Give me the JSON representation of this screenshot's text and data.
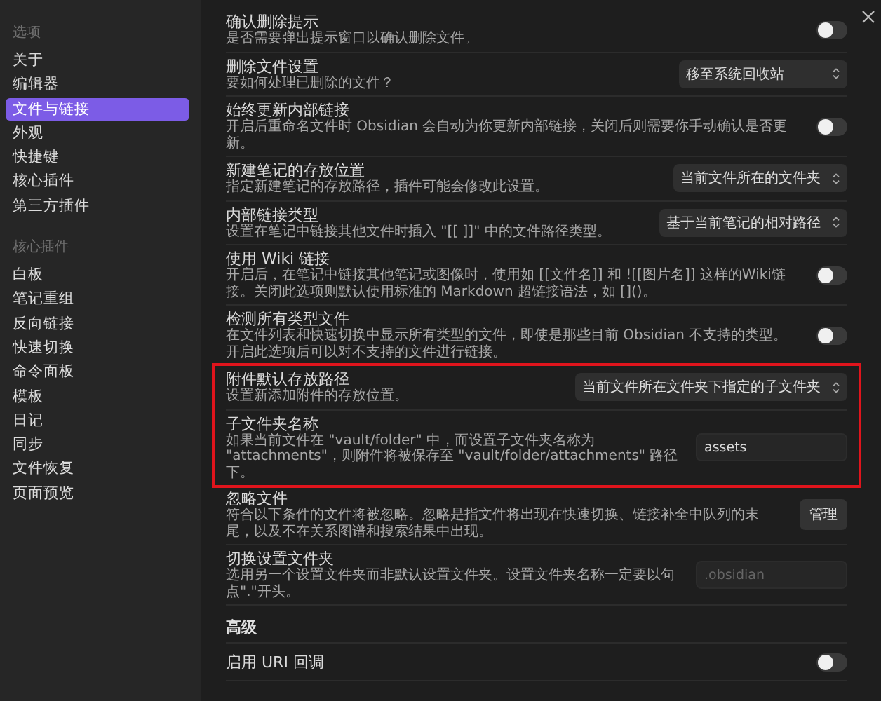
{
  "sidebar": {
    "sections": [
      {
        "heading": "选项",
        "items": [
          {
            "label": "关于",
            "selected": false
          },
          {
            "label": "编辑器",
            "selected": false
          },
          {
            "label": "文件与链接",
            "selected": true
          },
          {
            "label": "外观",
            "selected": false
          },
          {
            "label": "快捷键",
            "selected": false
          },
          {
            "label": "核心插件",
            "selected": false
          },
          {
            "label": "第三方插件",
            "selected": false
          }
        ]
      },
      {
        "heading": "核心插件",
        "items": [
          {
            "label": "白板",
            "selected": false
          },
          {
            "label": "笔记重组",
            "selected": false
          },
          {
            "label": "反向链接",
            "selected": false
          },
          {
            "label": "快速切换",
            "selected": false
          },
          {
            "label": "命令面板",
            "selected": false
          },
          {
            "label": "模板",
            "selected": false
          },
          {
            "label": "日记",
            "selected": false
          },
          {
            "label": "同步",
            "selected": false
          },
          {
            "label": "文件恢复",
            "selected": false
          },
          {
            "label": "页面预览",
            "selected": false
          }
        ]
      }
    ]
  },
  "settings": {
    "groups": [
      {
        "highlighted": false,
        "items": [
          {
            "title": "确认删除提示",
            "description": "是否需要弹出提示窗口以确认删除文件。",
            "kind": "toggle",
            "on": false
          },
          {
            "title": "删除文件设置",
            "description": "要如何处理已删除的文件？",
            "kind": "dropdown",
            "value": "移至系统回收站",
            "wide": true
          },
          {
            "title": "始终更新内部链接",
            "description": "开启后重命名文件时 Obsidian 会自动为你更新内部链接，关闭后则需要你手动确认是否更新。",
            "kind": "toggle",
            "on": false
          },
          {
            "title": "新建笔记的存放位置",
            "description": "指定新建笔记的存放路径，插件可能会修改此设置。",
            "kind": "dropdown",
            "value": "当前文件所在的文件夹",
            "wide": false
          },
          {
            "title": "内部链接类型",
            "description": "设置在笔记中链接其他文件时插入 \"[[ ]]\" 中的文件路径类型。",
            "kind": "dropdown",
            "value": "基于当前笔记的相对路径",
            "wide": false
          },
          {
            "title": "使用 Wiki 链接",
            "description": "开启后，在笔记中链接其他笔记或图像时，使用如 [[文件名]] 和 ![[图片名]] 这样的Wiki链接。关闭此选项则默认使用标准的 Markdown 超链接语法，如 []()。",
            "kind": "toggle",
            "on": false
          },
          {
            "title": "检测所有类型文件",
            "description": "在文件列表和快速切换中显示所有类型的文件，即使是那些目前 Obsidian 不支持的类型。开启此选项后可以对不支持的文件进行链接。",
            "kind": "toggle",
            "on": false
          }
        ]
      },
      {
        "highlighted": true,
        "items": [
          {
            "title": "附件默认存放路径",
            "description": "设置新添加附件的存放位置。",
            "kind": "dropdown",
            "value": "当前文件所在文件夹下指定的子文件夹",
            "wide": false
          },
          {
            "title": "子文件夹名称",
            "description": "如果当前文件在 \"vault/folder\" 中，而设置子文件夹名称为 \"attachments\"，则附件将被保存至 \"vault/folder/attachments\" 路径下。",
            "kind": "text",
            "value": "assets"
          }
        ]
      },
      {
        "highlighted": false,
        "items": [
          {
            "title": "忽略文件",
            "description": "符合以下条件的文件将被忽略。忽略是指文件将出现在快速切换、链接补全中队列的末尾，以及不在关系图谱和搜索结果中出现。",
            "kind": "button",
            "label": "管理"
          },
          {
            "title": "切换设置文件夹",
            "description": "选用另一个设置文件夹而非默认设置文件夹。设置文件夹名称一定要以句点\".\"开头。",
            "kind": "text",
            "placeholder": ".obsidian"
          }
        ]
      }
    ],
    "advanced": {
      "heading": "高级",
      "items": [
        {
          "title": "启用 URI 回调",
          "kind": "toggle",
          "on": false
        }
      ]
    }
  }
}
